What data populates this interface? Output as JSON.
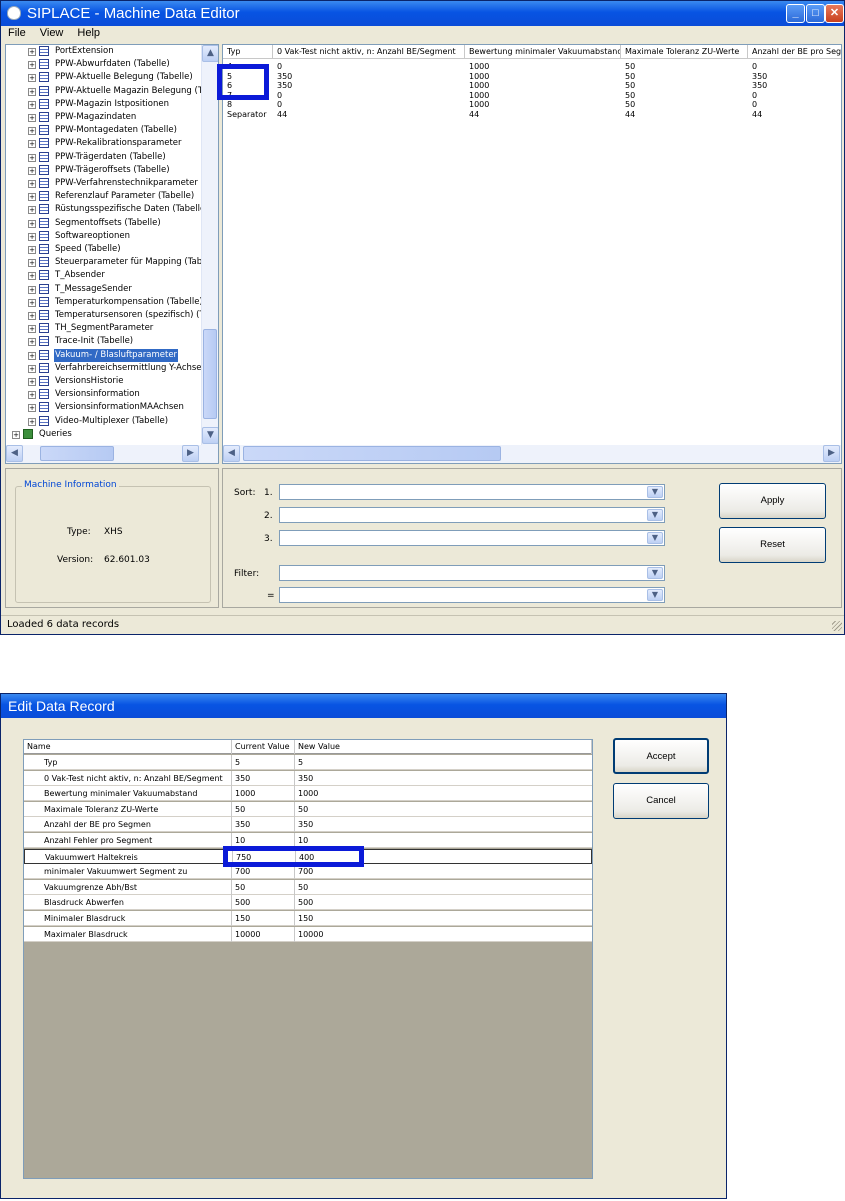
{
  "window1": {
    "title": "SIPLACE - Machine Data Editor",
    "menu": [
      "File",
      "View",
      "Help"
    ],
    "tree": {
      "items": [
        "PortExtension",
        "PPW-Abwurfdaten (Tabelle)",
        "PPW-Aktuelle Belegung (Tabelle)",
        "PPW-Aktuelle Magazin Belegung (Ta",
        "PPW-Magazin Istpositionen",
        "PPW-Magazindaten",
        "PPW-Montagedaten (Tabelle)",
        "PPW-Rekalibrationsparameter",
        "PPW-Trägerdaten (Tabelle)",
        "PPW-Trägeroffsets (Tabelle)",
        "PPW-Verfahrenstechnikparameter",
        "Referenzlauf Parameter (Tabelle)",
        "Rüstungsspezifische Daten (Tabelle",
        "Segmentoffsets (Tabelle)",
        "Softwareoptionen",
        "Speed (Tabelle)",
        "Steuerparameter für Mapping (Tab",
        "T_Absender",
        "T_MessageSender",
        "Temperaturkompensation (Tabelle)",
        "Temperatursensoren (spezifisch) (T",
        "TH_SegmentParameter",
        "Trace-Init (Tabelle)",
        "Vakuum- / Blasluftparameter",
        "Verfahrbereichsermittlung Y-Achse",
        "VersionsHistorie",
        "Versionsinformation",
        "VersionsinformationMAAchsen",
        "Video-Multiplexer (Tabelle)"
      ],
      "selected_index": 23,
      "queries_label": "Queries"
    },
    "grid": {
      "columns": [
        "Typ",
        "0 Vak-Test nicht aktiv, n: Anzahl BE/Segment",
        "Bewertung minimaler Vakuumabstand",
        "Maximale Toleranz ZU-Werte",
        "Anzahl der BE pro Seg"
      ],
      "rows": [
        [
          "4",
          "0",
          "1000",
          "50",
          "0"
        ],
        [
          "5",
          "350",
          "1000",
          "50",
          "350"
        ],
        [
          "6",
          "350",
          "1000",
          "50",
          "350"
        ],
        [
          "7",
          "0",
          "1000",
          "50",
          "0"
        ],
        [
          "8",
          "0",
          "1000",
          "50",
          "0"
        ],
        [
          "Separator",
          "44",
          "44",
          "44",
          "44"
        ]
      ]
    },
    "machine_info": {
      "group_label": "Machine Information",
      "type_label": "Type:",
      "type_value": "XHS",
      "version_label": "Version:",
      "version_value": "62.601.03"
    },
    "sort": {
      "sort_label": "Sort:",
      "n1": "1.",
      "n2": "2.",
      "n3": "3.",
      "filter_label": "Filter:",
      "equals": "=",
      "apply": "Apply",
      "reset": "Reset"
    },
    "status": "Loaded 6 data records"
  },
  "window2": {
    "title": "Edit Data Record",
    "columns": [
      "Name",
      "Current Value",
      "New Value"
    ],
    "rows": [
      [
        "Typ",
        "5",
        "5"
      ],
      [
        "0 Vak-Test nicht aktiv, n: Anzahl BE/Segment",
        "350",
        "350"
      ],
      [
        "Bewertung minimaler Vakuumabstand",
        "1000",
        "1000"
      ],
      [
        "Maximale Toleranz ZU-Werte",
        "50",
        "50"
      ],
      [
        "Anzahl der BE pro Segmen",
        "350",
        "350"
      ],
      [
        "Anzahl Fehler pro Segment",
        "10",
        "10"
      ],
      [
        "Vakuumwert Haltekreis",
        "750",
        "400"
      ],
      [
        "minimaler Vakuumwert Segment zu",
        "700",
        "700"
      ],
      [
        "Vakuumgrenze Abh/Bst",
        "50",
        "50"
      ],
      [
        "Blasdruck Abwerfen",
        "500",
        "500"
      ],
      [
        "Minimaler Blasdruck",
        "150",
        "150"
      ],
      [
        "Maximaler Blasdruck",
        "10000",
        "10000"
      ]
    ],
    "accept": "Accept",
    "cancel": "Cancel"
  }
}
